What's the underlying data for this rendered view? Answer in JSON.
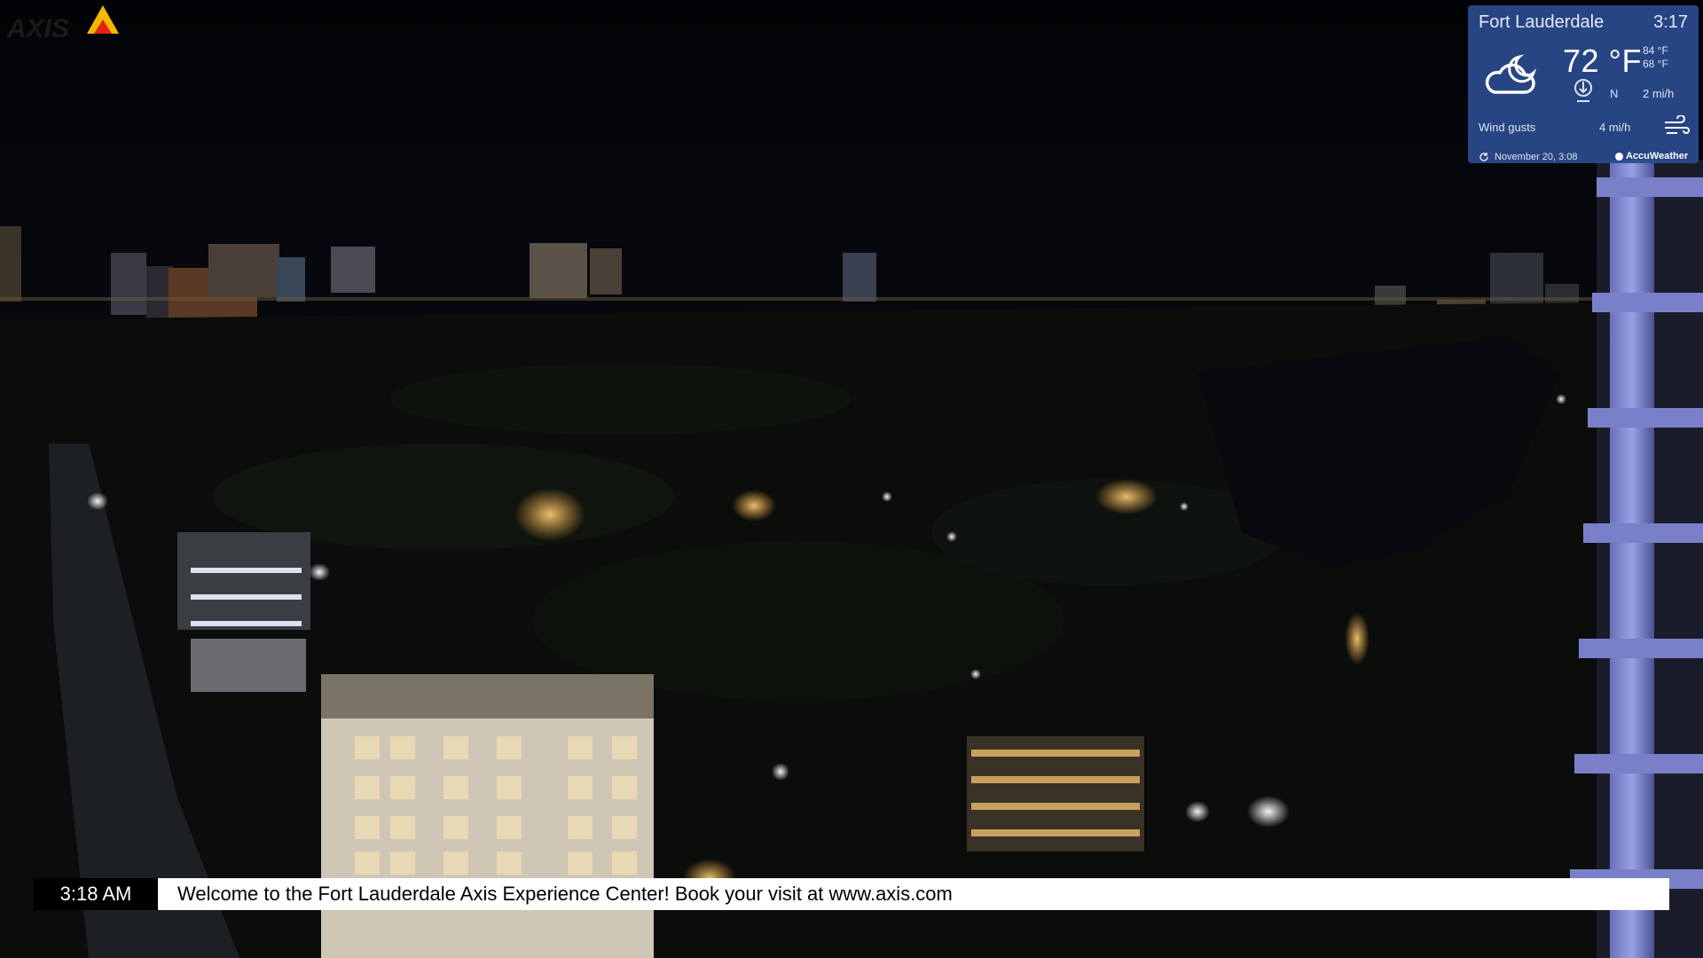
{
  "logo": {
    "text": "AXIS"
  },
  "weather": {
    "city": "Fort Lauderdale",
    "time": "3:17",
    "temperature": "72 °F",
    "high": "84 °F",
    "low": "68 °F",
    "wind_direction": "N",
    "wind_speed": "2 mi/h",
    "gusts_label": "Wind gusts",
    "gusts_value": "4 mi/h",
    "updated": "November 20, 3:08",
    "provider": "AccuWeather",
    "condition_icon": "partly-cloudy-night-icon"
  },
  "ticker": {
    "clock": "3:18 AM",
    "message": "Welcome to the Fort Lauderdale Axis Experience Center! Book your visit at www.axis.com"
  },
  "colors": {
    "sky": "#05060a",
    "weather_panel": "#2a4a8c",
    "axis_logo_yellow": "#f5b800",
    "axis_logo_red": "#e2231a"
  }
}
